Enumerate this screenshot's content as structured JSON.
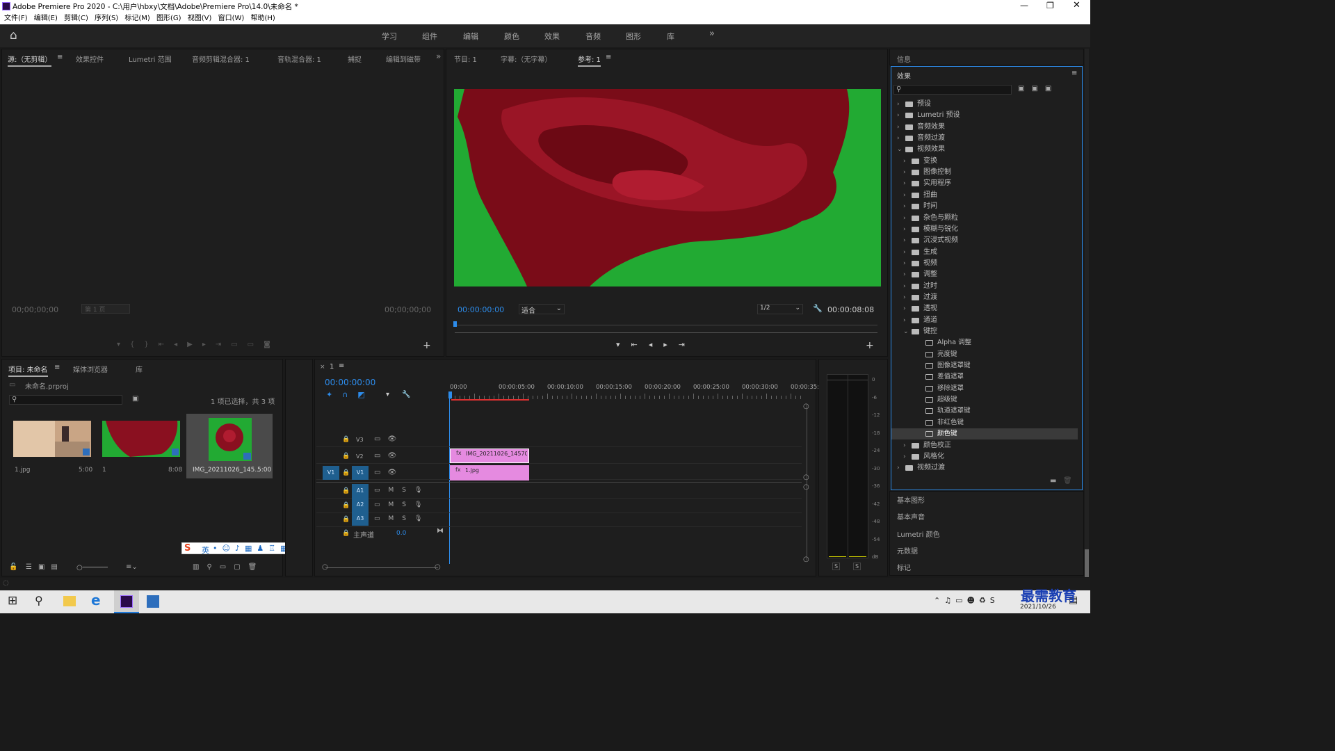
{
  "window": {
    "title": "Adobe Premiere Pro 2020 - C:\\用户\\hbxy\\文档\\Adobe\\Premiere Pro\\14.0\\未命名 *"
  },
  "menu": [
    "文件(F)",
    "编辑(E)",
    "剪辑(C)",
    "序列(S)",
    "标记(M)",
    "图形(G)",
    "视图(V)",
    "窗口(W)",
    "帮助(H)"
  ],
  "workspaces": [
    "学习",
    "组件",
    "编辑",
    "颜色",
    "效果",
    "音频",
    "图形",
    "库"
  ],
  "source_panel": {
    "tabs": [
      "源:（无剪辑）",
      "效果控件",
      "Lumetri 范围",
      "音频剪辑混合器: 1",
      "音轨混合器: 1",
      "捕捉",
      "编辑到磁带"
    ],
    "tc_left": "00;00;00;00",
    "page": "第 1 页",
    "tc_right": "00;00;00;00"
  },
  "program_panel": {
    "tabs": [
      "节目: 1",
      "字幕:（无字幕）",
      "参考: 1"
    ],
    "timecode": "00:00:00:00",
    "fit": "适合",
    "resolution": "1/2",
    "duration": "00:00:08:08"
  },
  "info_panel": {
    "title": "信息"
  },
  "effects_panel": {
    "title": "效果",
    "items": [
      {
        "label": "预设",
        "depth": 0,
        "open": false,
        "type": "folder"
      },
      {
        "label": "Lumetri 预设",
        "depth": 0,
        "open": false,
        "type": "folder"
      },
      {
        "label": "音频效果",
        "depth": 0,
        "open": false,
        "type": "folder"
      },
      {
        "label": "音频过渡",
        "depth": 0,
        "open": false,
        "type": "folder"
      },
      {
        "label": "视频效果",
        "depth": 0,
        "open": true,
        "type": "folder"
      },
      {
        "label": "变换",
        "depth": 1,
        "open": false,
        "type": "folder"
      },
      {
        "label": "图像控制",
        "depth": 1,
        "open": false,
        "type": "folder"
      },
      {
        "label": "实用程序",
        "depth": 1,
        "open": false,
        "type": "folder"
      },
      {
        "label": "扭曲",
        "depth": 1,
        "open": false,
        "type": "folder"
      },
      {
        "label": "时间",
        "depth": 1,
        "open": false,
        "type": "folder"
      },
      {
        "label": "杂色与颗粒",
        "depth": 1,
        "open": false,
        "type": "folder"
      },
      {
        "label": "模糊与锐化",
        "depth": 1,
        "open": false,
        "type": "folder"
      },
      {
        "label": "沉浸式视频",
        "depth": 1,
        "open": false,
        "type": "folder"
      },
      {
        "label": "生成",
        "depth": 1,
        "open": false,
        "type": "folder"
      },
      {
        "label": "视频",
        "depth": 1,
        "open": false,
        "type": "folder"
      },
      {
        "label": "调整",
        "depth": 1,
        "open": false,
        "type": "folder"
      },
      {
        "label": "过时",
        "depth": 1,
        "open": false,
        "type": "folder"
      },
      {
        "label": "过渡",
        "depth": 1,
        "open": false,
        "type": "folder"
      },
      {
        "label": "透视",
        "depth": 1,
        "open": false,
        "type": "folder"
      },
      {
        "label": "通道",
        "depth": 1,
        "open": false,
        "type": "folder"
      },
      {
        "label": "键控",
        "depth": 1,
        "open": true,
        "type": "folder"
      },
      {
        "label": "Alpha 调整",
        "depth": 2,
        "type": "effect"
      },
      {
        "label": "亮度键",
        "depth": 2,
        "type": "effect"
      },
      {
        "label": "图像遮罩键",
        "depth": 2,
        "type": "effect"
      },
      {
        "label": "差值遮罩",
        "depth": 2,
        "type": "effect"
      },
      {
        "label": "移除遮罩",
        "depth": 2,
        "type": "effect"
      },
      {
        "label": "超级键",
        "depth": 2,
        "type": "effect"
      },
      {
        "label": "轨道遮罩键",
        "depth": 2,
        "type": "effect"
      },
      {
        "label": "非红色键",
        "depth": 2,
        "type": "effect"
      },
      {
        "label": "颜色键",
        "depth": 2,
        "type": "effect",
        "selected": true
      },
      {
        "label": "颜色校正",
        "depth": 1,
        "open": false,
        "type": "folder"
      },
      {
        "label": "风格化",
        "depth": 1,
        "open": false,
        "type": "folder"
      },
      {
        "label": "视频过渡",
        "depth": 0,
        "open": false,
        "type": "folder"
      }
    ]
  },
  "right_panels": [
    "基本图形",
    "基本声音",
    "Lumetri 颜色",
    "元数据",
    "标记"
  ],
  "project_panel": {
    "tabs": [
      "项目: 未命名",
      "媒体浏览器",
      "库"
    ],
    "file": "未命名.prproj",
    "selection": "1 项已选择，共 3 项",
    "items": [
      {
        "name": "1.jpg",
        "dur": "5:00"
      },
      {
        "name": "1",
        "dur": "8:08"
      },
      {
        "name": "IMG_20211026_145...",
        "dur": "5:00"
      }
    ]
  },
  "timeline": {
    "tab": "1",
    "timecode": "00:00:00:00",
    "ruler": [
      "00:00",
      "00:00:05:00",
      "00:00:10:00",
      "00:00:15:00",
      "00:00:20:00",
      "00:00:25:00",
      "00:00:30:00",
      "00:00:35:0"
    ],
    "video_tracks": [
      "V3",
      "V2",
      "V1"
    ],
    "audio_tracks": [
      "A1",
      "A2",
      "A3"
    ],
    "src_v": "V1",
    "master": "主声道",
    "master_val": "0.0",
    "clips": {
      "v2": "IMG_20211026_145700 (",
      "v1": "1.jpg"
    }
  },
  "meter": {
    "scale": [
      "0",
      "-6",
      "-12",
      "-18",
      "-24",
      "-30",
      "-36",
      "-42",
      "-48",
      "-54",
      "dB"
    ],
    "solo": [
      "S",
      "S"
    ]
  },
  "ime": {
    "lang": "英"
  },
  "taskbar": {
    "date": "2021/10/26"
  },
  "watermark": "最需教育",
  "colors": {
    "accent": "#2d8ceb",
    "clip": "#e58ae0",
    "screen": "#22aa33"
  }
}
